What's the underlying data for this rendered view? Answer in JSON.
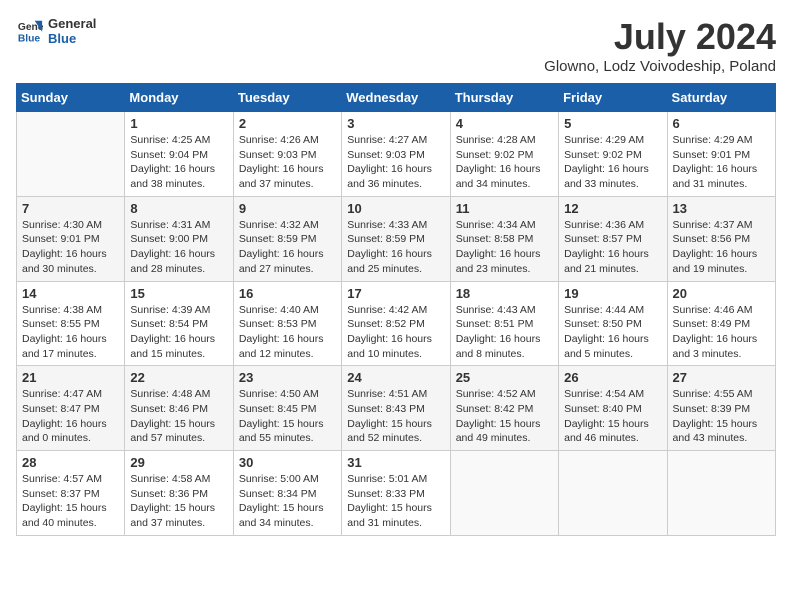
{
  "header": {
    "logo_line1": "General",
    "logo_line2": "Blue",
    "month": "July 2024",
    "location": "Glowno, Lodz Voivodeship, Poland"
  },
  "weekdays": [
    "Sunday",
    "Monday",
    "Tuesday",
    "Wednesday",
    "Thursday",
    "Friday",
    "Saturday"
  ],
  "weeks": [
    [
      {
        "day": "",
        "info": ""
      },
      {
        "day": "1",
        "info": "Sunrise: 4:25 AM\nSunset: 9:04 PM\nDaylight: 16 hours\nand 38 minutes."
      },
      {
        "day": "2",
        "info": "Sunrise: 4:26 AM\nSunset: 9:03 PM\nDaylight: 16 hours\nand 37 minutes."
      },
      {
        "day": "3",
        "info": "Sunrise: 4:27 AM\nSunset: 9:03 PM\nDaylight: 16 hours\nand 36 minutes."
      },
      {
        "day": "4",
        "info": "Sunrise: 4:28 AM\nSunset: 9:02 PM\nDaylight: 16 hours\nand 34 minutes."
      },
      {
        "day": "5",
        "info": "Sunrise: 4:29 AM\nSunset: 9:02 PM\nDaylight: 16 hours\nand 33 minutes."
      },
      {
        "day": "6",
        "info": "Sunrise: 4:29 AM\nSunset: 9:01 PM\nDaylight: 16 hours\nand 31 minutes."
      }
    ],
    [
      {
        "day": "7",
        "info": "Sunrise: 4:30 AM\nSunset: 9:01 PM\nDaylight: 16 hours\nand 30 minutes."
      },
      {
        "day": "8",
        "info": "Sunrise: 4:31 AM\nSunset: 9:00 PM\nDaylight: 16 hours\nand 28 minutes."
      },
      {
        "day": "9",
        "info": "Sunrise: 4:32 AM\nSunset: 8:59 PM\nDaylight: 16 hours\nand 27 minutes."
      },
      {
        "day": "10",
        "info": "Sunrise: 4:33 AM\nSunset: 8:59 PM\nDaylight: 16 hours\nand 25 minutes."
      },
      {
        "day": "11",
        "info": "Sunrise: 4:34 AM\nSunset: 8:58 PM\nDaylight: 16 hours\nand 23 minutes."
      },
      {
        "day": "12",
        "info": "Sunrise: 4:36 AM\nSunset: 8:57 PM\nDaylight: 16 hours\nand 21 minutes."
      },
      {
        "day": "13",
        "info": "Sunrise: 4:37 AM\nSunset: 8:56 PM\nDaylight: 16 hours\nand 19 minutes."
      }
    ],
    [
      {
        "day": "14",
        "info": "Sunrise: 4:38 AM\nSunset: 8:55 PM\nDaylight: 16 hours\nand 17 minutes."
      },
      {
        "day": "15",
        "info": "Sunrise: 4:39 AM\nSunset: 8:54 PM\nDaylight: 16 hours\nand 15 minutes."
      },
      {
        "day": "16",
        "info": "Sunrise: 4:40 AM\nSunset: 8:53 PM\nDaylight: 16 hours\nand 12 minutes."
      },
      {
        "day": "17",
        "info": "Sunrise: 4:42 AM\nSunset: 8:52 PM\nDaylight: 16 hours\nand 10 minutes."
      },
      {
        "day": "18",
        "info": "Sunrise: 4:43 AM\nSunset: 8:51 PM\nDaylight: 16 hours\nand 8 minutes."
      },
      {
        "day": "19",
        "info": "Sunrise: 4:44 AM\nSunset: 8:50 PM\nDaylight: 16 hours\nand 5 minutes."
      },
      {
        "day": "20",
        "info": "Sunrise: 4:46 AM\nSunset: 8:49 PM\nDaylight: 16 hours\nand 3 minutes."
      }
    ],
    [
      {
        "day": "21",
        "info": "Sunrise: 4:47 AM\nSunset: 8:47 PM\nDaylight: 16 hours\nand 0 minutes."
      },
      {
        "day": "22",
        "info": "Sunrise: 4:48 AM\nSunset: 8:46 PM\nDaylight: 15 hours\nand 57 minutes."
      },
      {
        "day": "23",
        "info": "Sunrise: 4:50 AM\nSunset: 8:45 PM\nDaylight: 15 hours\nand 55 minutes."
      },
      {
        "day": "24",
        "info": "Sunrise: 4:51 AM\nSunset: 8:43 PM\nDaylight: 15 hours\nand 52 minutes."
      },
      {
        "day": "25",
        "info": "Sunrise: 4:52 AM\nSunset: 8:42 PM\nDaylight: 15 hours\nand 49 minutes."
      },
      {
        "day": "26",
        "info": "Sunrise: 4:54 AM\nSunset: 8:40 PM\nDaylight: 15 hours\nand 46 minutes."
      },
      {
        "day": "27",
        "info": "Sunrise: 4:55 AM\nSunset: 8:39 PM\nDaylight: 15 hours\nand 43 minutes."
      }
    ],
    [
      {
        "day": "28",
        "info": "Sunrise: 4:57 AM\nSunset: 8:37 PM\nDaylight: 15 hours\nand 40 minutes."
      },
      {
        "day": "29",
        "info": "Sunrise: 4:58 AM\nSunset: 8:36 PM\nDaylight: 15 hours\nand 37 minutes."
      },
      {
        "day": "30",
        "info": "Sunrise: 5:00 AM\nSunset: 8:34 PM\nDaylight: 15 hours\nand 34 minutes."
      },
      {
        "day": "31",
        "info": "Sunrise: 5:01 AM\nSunset: 8:33 PM\nDaylight: 15 hours\nand 31 minutes."
      },
      {
        "day": "",
        "info": ""
      },
      {
        "day": "",
        "info": ""
      },
      {
        "day": "",
        "info": ""
      }
    ]
  ]
}
